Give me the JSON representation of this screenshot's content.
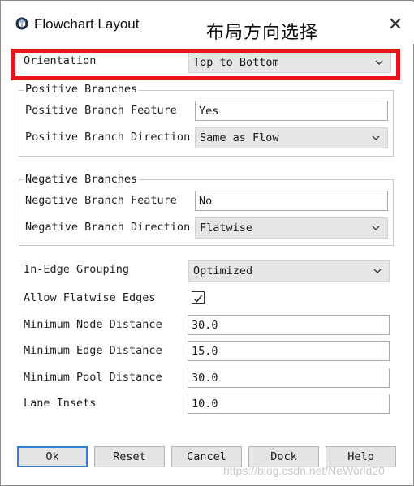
{
  "window": {
    "title": "Flowchart Layout",
    "annotation": "布局方向选择",
    "close": "✕",
    "icon": "cube-icon"
  },
  "orientation": {
    "label": "Orientation",
    "value": "Top to Bottom"
  },
  "positive_branches": {
    "title": "Positive Branches",
    "feature_label": "Positive Branch Feature",
    "feature_value": "Yes",
    "direction_label": "Positive Branch Direction",
    "direction_value": "Same as Flow"
  },
  "negative_branches": {
    "title": "Negative Branches",
    "feature_label": "Negative Branch Feature",
    "feature_value": "No",
    "direction_label": "Negative Branch Direction",
    "direction_value": "Flatwise"
  },
  "in_edge_grouping": {
    "label": "In-Edge Grouping",
    "value": "Optimized"
  },
  "allow_flatwise_edges": {
    "label": "Allow Flatwise Edges",
    "checked": true
  },
  "min_node_distance": {
    "label": "Minimum Node Distance",
    "value": "30.0"
  },
  "min_edge_distance": {
    "label": "Minimum Edge Distance",
    "value": "15.0"
  },
  "min_pool_distance": {
    "label": "Minimum Pool Distance",
    "value": "30.0"
  },
  "lane_insets": {
    "label": "Lane Insets",
    "value": "10.0"
  },
  "buttons": {
    "ok": "Ok",
    "reset": "Reset",
    "cancel": "Cancel",
    "dock": "Dock",
    "help": "Help"
  },
  "watermark": "https://blog.csdn.net/NeWorld20",
  "colors": {
    "highlight": "#e8141c",
    "default_button_border": "#2f7fd6"
  }
}
